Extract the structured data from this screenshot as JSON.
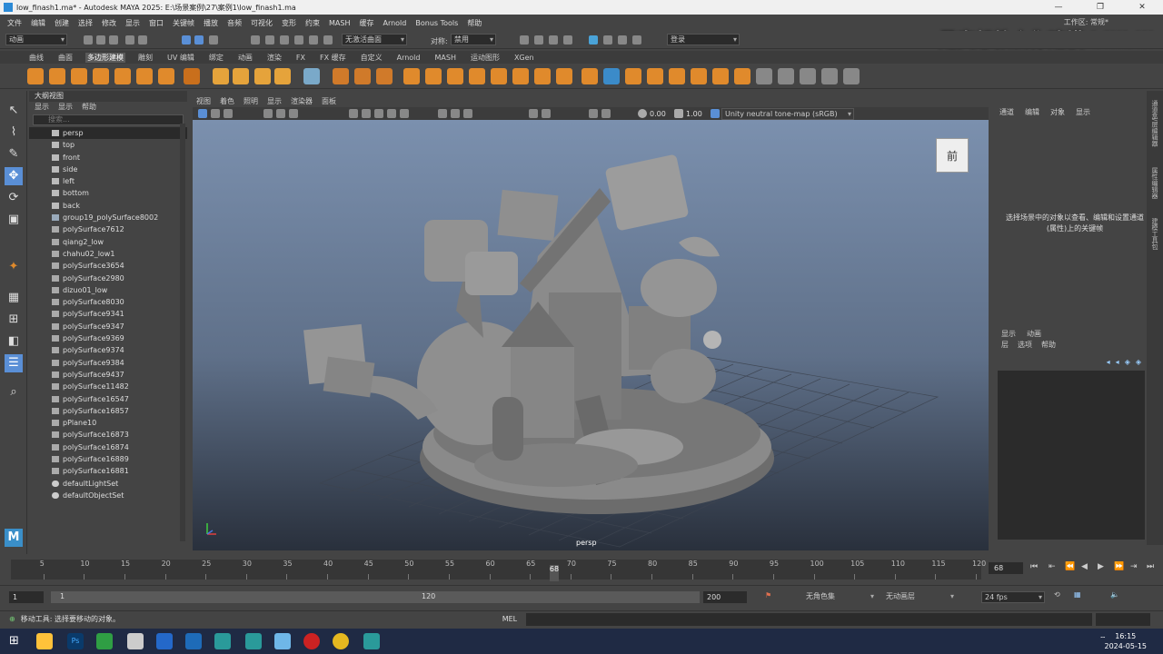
{
  "window": {
    "title": "low_finash1.ma* - Autodesk MAYA 2025: E:\\场景案例\\27\\案例1\\low_finash1.ma",
    "controls": [
      "—",
      "❐",
      "✕"
    ]
  },
  "menubar": [
    "文件",
    "编辑",
    "创建",
    "选择",
    "修改",
    "显示",
    "窗口",
    "关键帧",
    "播放",
    "音频",
    "可视化",
    "变形",
    "约束",
    "MASH",
    "缓存",
    "Arnold",
    "Bonus Tools",
    "帮助"
  ],
  "workspace": {
    "label": "工作区:",
    "value": "常规*"
  },
  "watermark": "是真想教会你建模  bilibili",
  "statusline": {
    "menuset": "动画",
    "live_surface": "无激活曲面",
    "symmetry_label": "对称:",
    "symmetry_value": "禁用",
    "login": "登录"
  },
  "shelf_tabs": [
    "曲线",
    "曲面",
    "多边形建模",
    "雕刻",
    "UV 编辑",
    "绑定",
    "动画",
    "渲染",
    "FX",
    "FX 缓存",
    "自定义",
    "Arnold",
    "MASH",
    "运动图形",
    "XGen"
  ],
  "shelf_active": "多边形建模",
  "outliner": {
    "title": "大纲视图",
    "menu": [
      "显示",
      "显示",
      "帮助"
    ],
    "search_placeholder": "搜索...",
    "items": [
      {
        "name": "persp",
        "type": "camera"
      },
      {
        "name": "top",
        "type": "camera"
      },
      {
        "name": "front",
        "type": "camera"
      },
      {
        "name": "side",
        "type": "camera"
      },
      {
        "name": "left",
        "type": "camera"
      },
      {
        "name": "bottom",
        "type": "camera"
      },
      {
        "name": "back",
        "type": "camera"
      },
      {
        "name": "group19_polySurface8002",
        "type": "group"
      },
      {
        "name": "polySurface7612",
        "type": "mesh"
      },
      {
        "name": "qiang2_low",
        "type": "mesh"
      },
      {
        "name": "chahu02_low1",
        "type": "mesh"
      },
      {
        "name": "polySurface3654",
        "type": "mesh"
      },
      {
        "name": "polySurface2980",
        "type": "mesh"
      },
      {
        "name": "dizuo01_low",
        "type": "mesh"
      },
      {
        "name": "polySurface8030",
        "type": "mesh"
      },
      {
        "name": "polySurface9341",
        "type": "mesh"
      },
      {
        "name": "polySurface9347",
        "type": "mesh"
      },
      {
        "name": "polySurface9369",
        "type": "mesh"
      },
      {
        "name": "polySurface9374",
        "type": "mesh"
      },
      {
        "name": "polySurface9384",
        "type": "mesh"
      },
      {
        "name": "polySurface9437",
        "type": "mesh"
      },
      {
        "name": "polySurface11482",
        "type": "mesh"
      },
      {
        "name": "polySurface16547",
        "type": "mesh"
      },
      {
        "name": "polySurface16857",
        "type": "mesh"
      },
      {
        "name": "pPlane10",
        "type": "mesh"
      },
      {
        "name": "polySurface16873",
        "type": "mesh"
      },
      {
        "name": "polySurface16874",
        "type": "mesh"
      },
      {
        "name": "polySurface16889",
        "type": "mesh"
      },
      {
        "name": "polySurface16881",
        "type": "mesh"
      },
      {
        "name": "defaultLightSet",
        "type": "set"
      },
      {
        "name": "defaultObjectSet",
        "type": "set"
      }
    ]
  },
  "viewport": {
    "menu": [
      "视图",
      "着色",
      "照明",
      "显示",
      "渲染器",
      "面板"
    ],
    "exposure": "0.00",
    "gamma": "1.00",
    "colorspace": "Unity neutral tone-map (sRGB)",
    "camera_label": "persp",
    "viewcube_face": "前"
  },
  "channelbox": {
    "menu": [
      "通道",
      "编辑",
      "对象",
      "显示"
    ],
    "message": "选择场景中的对象以查看、编辑和设置通道(属性)上的关键帧"
  },
  "side_tabs": [
    "通道盒/层编辑器",
    "属性编辑器",
    "建模工具包"
  ],
  "layer_editor": {
    "tabs": [
      "显示",
      "动画"
    ],
    "menu": [
      "层",
      "选项",
      "帮助"
    ]
  },
  "timeline": {
    "ticks": [
      5,
      10,
      15,
      20,
      25,
      30,
      35,
      40,
      45,
      50,
      55,
      60,
      65,
      70,
      75,
      80,
      85,
      90,
      95,
      100,
      105,
      110,
      115,
      120
    ],
    "current_frame": "68",
    "current_frame_field": "68",
    "start": 1,
    "end": 120
  },
  "range": {
    "start": "1",
    "start_inner": "1",
    "end_inner": "120",
    "end": "200",
    "character_set": "无角色集",
    "anim_layer": "无动画层",
    "fps": "24 fps"
  },
  "cmdline": {
    "help": "移动工具: 选择要移动的对象。",
    "lang": "MEL"
  },
  "taskbar": {
    "time": "16:15",
    "date": "2024-05-15"
  }
}
